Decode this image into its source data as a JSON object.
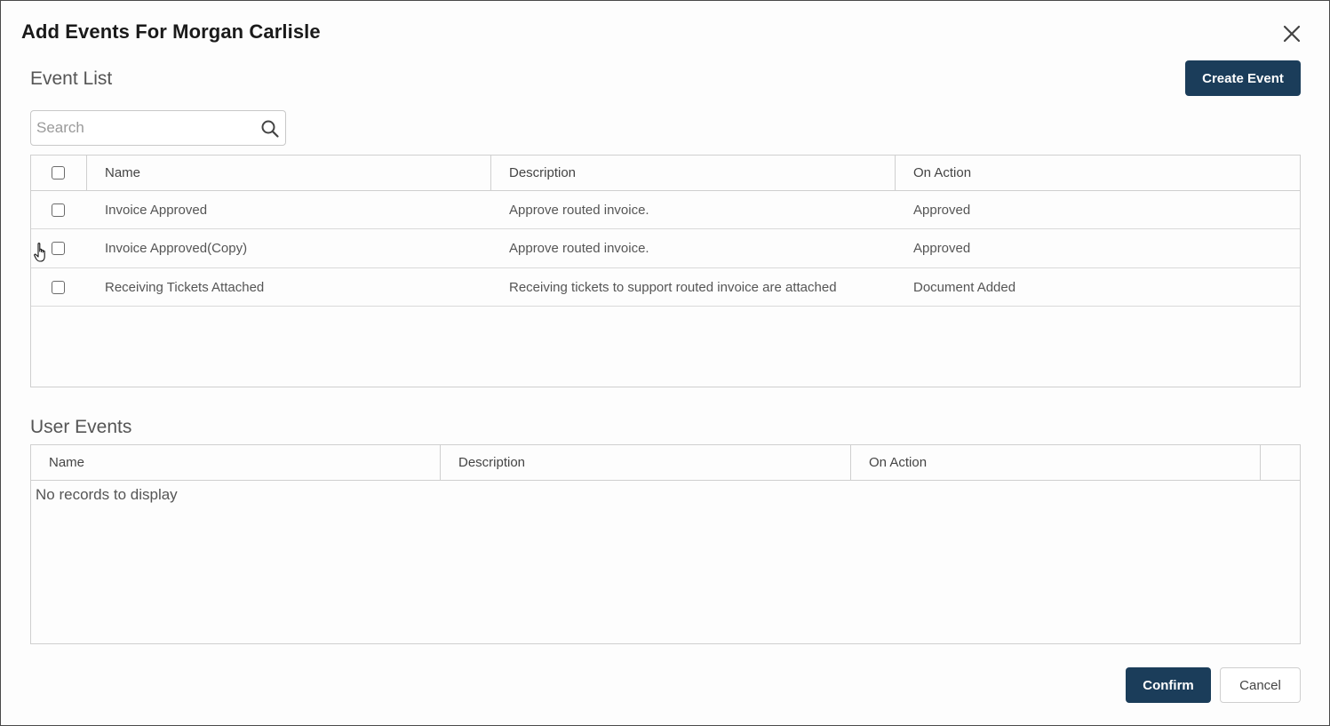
{
  "dialog": {
    "title": "Add Events For Morgan Carlisle",
    "close_icon": "close-icon"
  },
  "event_list": {
    "title": "Event List",
    "create_button": "Create Event",
    "search": {
      "placeholder": "Search",
      "value": "",
      "icon": "search-icon"
    },
    "columns": [
      "Name",
      "Description",
      "On Action"
    ],
    "rows": [
      {
        "checked": false,
        "name": "Invoice Approved",
        "description": "Approve routed invoice.",
        "on_action": "Approved"
      },
      {
        "checked": false,
        "name": "Invoice Approved(Copy)",
        "description": "Approve routed invoice.",
        "on_action": "Approved"
      },
      {
        "checked": false,
        "name": "Receiving Tickets Attached",
        "description": "Receiving tickets to support routed invoice are attached",
        "on_action": "Document Added"
      }
    ]
  },
  "user_events": {
    "title": "User Events",
    "columns": [
      "Name",
      "Description",
      "On Action"
    ],
    "empty_message": "No records to display"
  },
  "footer": {
    "confirm": "Confirm",
    "cancel": "Cancel"
  },
  "colors": {
    "primary": "#1b3d5a",
    "border": "#cfcfcf"
  }
}
